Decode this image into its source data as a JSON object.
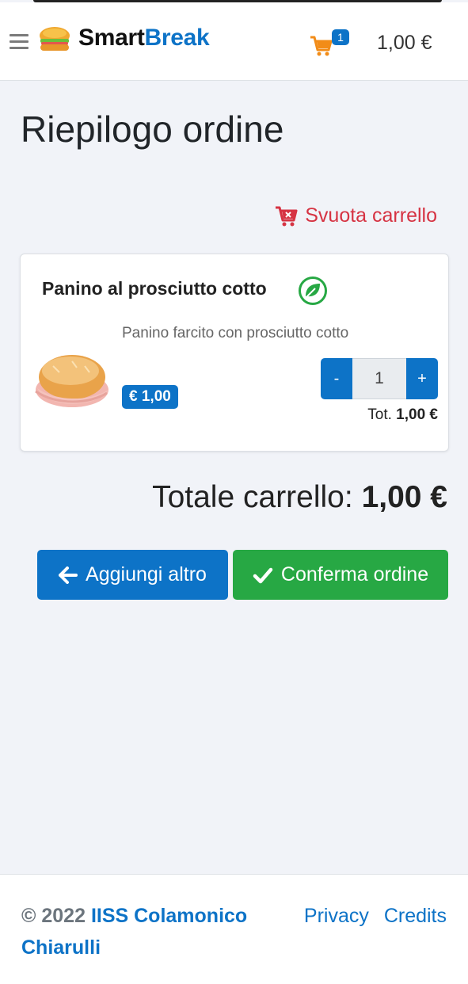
{
  "navbar": {
    "brand_part1": "Smart",
    "brand_part2": "Break",
    "cart_count": "1",
    "cart_total": "1,00 €"
  },
  "page": {
    "title": "Riepilogo ordine",
    "empty_cart_label": "Svuota carrello"
  },
  "cart_items": [
    {
      "name": "Panino al prosciutto cotto",
      "description": "Panino farcito con prosciutto cotto",
      "price": "€ 1,00",
      "quantity": "1",
      "minus_label": "-",
      "plus_label": "+",
      "total_label": "Tot.",
      "total_value": "1,00 €"
    }
  ],
  "summary": {
    "label": "Totale carrello:",
    "value": "1,00 €"
  },
  "actions": {
    "back_label": "Aggiungi altro",
    "confirm_label": "Conferma ordine"
  },
  "footer": {
    "copyright": "© 2022",
    "school": "IISS Colamonico Chiarulli",
    "links": [
      "Privacy",
      "Credits"
    ]
  },
  "colors": {
    "primary": "#0d73c7",
    "success": "#27a844",
    "danger": "#d63343",
    "background": "#f1f3f8"
  }
}
